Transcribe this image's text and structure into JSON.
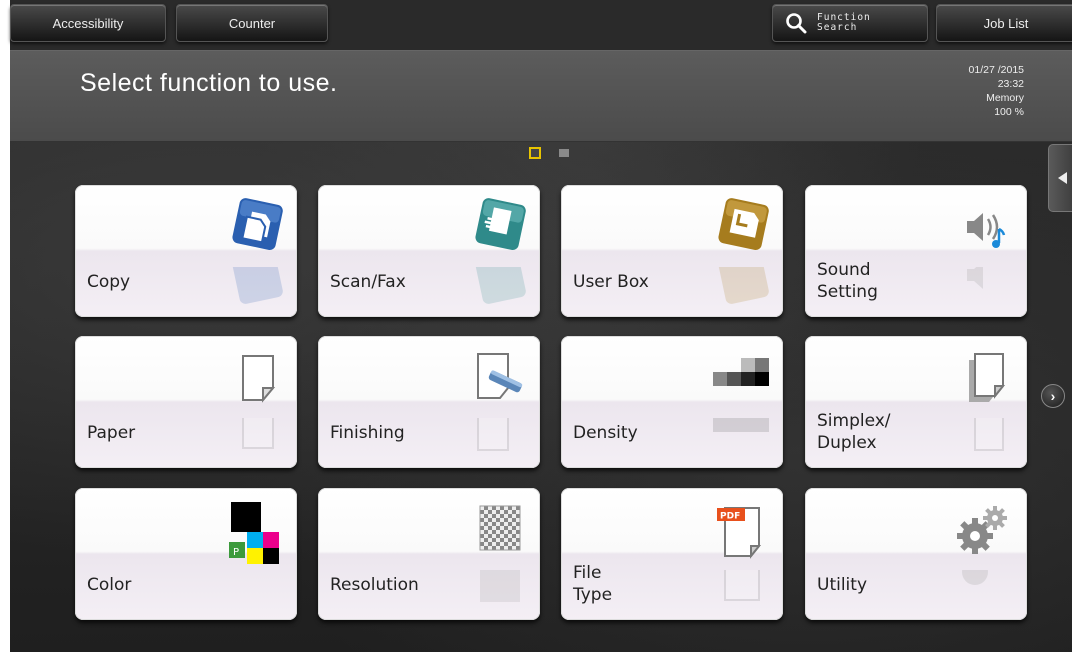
{
  "header": {
    "accessibility_label": "Accessibility",
    "counter_label": "Counter",
    "function_search_label": "Function\nSearch",
    "job_list_label": "Job List"
  },
  "message": {
    "text": "Select function to use.",
    "date": "01/27 /2015",
    "time": "23:32",
    "memory_label": "Memory",
    "memory_value": "100 %"
  },
  "pager": {
    "current_page": 1,
    "total_pages": 2
  },
  "tiles": [
    {
      "label": "Copy",
      "icon": "copy-icon"
    },
    {
      "label": "Scan/Fax",
      "icon": "scan-fax-icon"
    },
    {
      "label": "User Box",
      "icon": "user-box-icon"
    },
    {
      "label": "Sound\nSetting",
      "icon": "sound-setting-icon"
    },
    {
      "label": "Paper",
      "icon": "paper-icon"
    },
    {
      "label": "Finishing",
      "icon": "finishing-icon"
    },
    {
      "label": "Density",
      "icon": "density-icon"
    },
    {
      "label": "Simplex/\nDuplex",
      "icon": "simplex-duplex-icon"
    },
    {
      "label": "Color",
      "icon": "color-icon"
    },
    {
      "label": "Resolution",
      "icon": "resolution-icon"
    },
    {
      "label": "File\nType",
      "icon": "file-type-icon"
    },
    {
      "label": "Utility",
      "icon": "utility-icon"
    }
  ],
  "file_type_badge": "PDF",
  "colors": {
    "accent_page_dot": "#e8c400",
    "copy_blue": "#2a5fb0",
    "scan_teal": "#2f8a8a",
    "userbox_gold": "#a67c1e"
  }
}
